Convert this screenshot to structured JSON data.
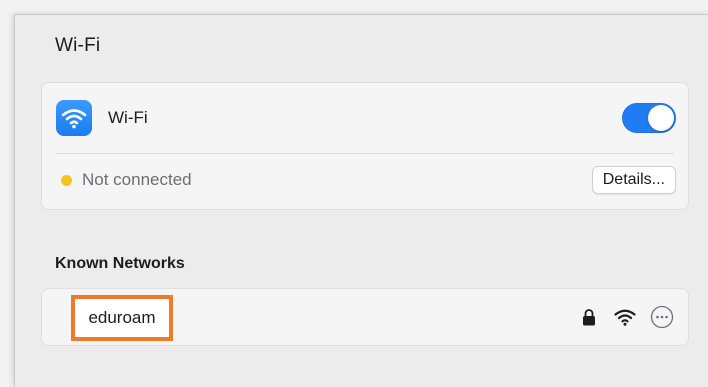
{
  "header": {
    "title": "Wi-Fi"
  },
  "wifi_card": {
    "label": "Wi-Fi",
    "toggle_on": true,
    "status_text": "Not connected",
    "details_label": "Details..."
  },
  "known_networks": {
    "title": "Known Networks",
    "items": [
      {
        "name": "eduroam",
        "secured": true,
        "highlighted": true
      }
    ]
  },
  "colors": {
    "accent": "#1f7cf2",
    "status_dot": "#f4c41a",
    "highlight_border": "#ee7b2b"
  },
  "icons": {
    "app": "wifi-icon",
    "lock": "lock-icon",
    "signal": "wifi-signal-icon",
    "more": "more-options-icon"
  }
}
